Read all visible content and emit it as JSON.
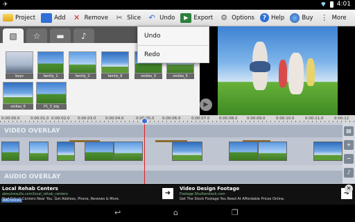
{
  "status": {
    "time": "4:01"
  },
  "toolbar": {
    "project": "Project",
    "add": "Add",
    "remove": "Remove",
    "slice": "Slice",
    "undo": "Undo",
    "export": "Export",
    "options": "Options",
    "help": "Help",
    "buy": "Buy",
    "more": "More"
  },
  "undo_menu": {
    "undo": "Undo",
    "redo": "Redo"
  },
  "media": [
    "boys",
    "family_1",
    "family_2",
    "family_6",
    "smiles_3",
    "smiles_5",
    "smiles_6",
    "P1_3_big"
  ],
  "ruler": [
    "0:00:00.0",
    "0:00:01.0",
    "0:00:02.0",
    "0:00:03.0",
    "0:00:04.0",
    "0:00:05.0",
    "0:00:06.0",
    "0:00:07.0",
    "0:00:08.0",
    "0:00:09.0",
    "0:00:10.0",
    "0:00:11.0",
    "0:00:12"
  ],
  "tracks": {
    "video_overlay": "VIDEO OVERLAY",
    "audio_overlay": "AUDIO OVERLAY"
  },
  "ads": [
    {
      "title": "Local Rehab Centers",
      "url": "aboutresults.com/local_rehab_centers",
      "desc": "Find Rehab Centers Near You. Get Address, Phone, Reviews & More."
    },
    {
      "title": "Video Design Footage",
      "url": "Footage.Shutterstock.com",
      "desc": "Get The Stock Footage You Need At Affordable Prices Online."
    }
  ],
  "adchoices": "AdChoices"
}
